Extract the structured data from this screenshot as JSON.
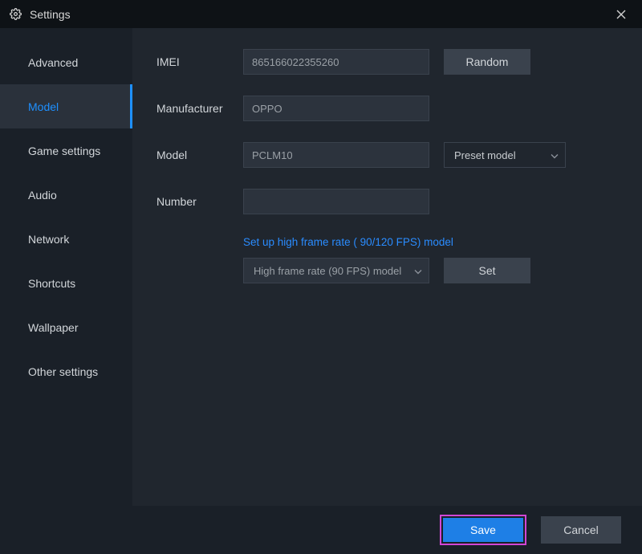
{
  "titlebar": {
    "title": "Settings"
  },
  "sidebar": {
    "items": [
      {
        "label": "Advanced"
      },
      {
        "label": "Model"
      },
      {
        "label": "Game settings"
      },
      {
        "label": "Audio"
      },
      {
        "label": "Network"
      },
      {
        "label": "Shortcuts"
      },
      {
        "label": "Wallpaper"
      },
      {
        "label": "Other settings"
      }
    ],
    "active_index": 1
  },
  "form": {
    "imei": {
      "label": "IMEI",
      "value": "865166022355260",
      "random_btn": "Random"
    },
    "manufacturer": {
      "label": "Manufacturer",
      "value": "OPPO"
    },
    "model": {
      "label": "Model",
      "value": "PCLM10",
      "preset_btn": "Preset model"
    },
    "number": {
      "label": "Number",
      "value": ""
    },
    "fps_link": "Set up high frame rate ( 90/120 FPS) model",
    "fps_select": "High frame rate (90 FPS) model",
    "set_btn": "Set"
  },
  "footer": {
    "save": "Save",
    "cancel": "Cancel"
  }
}
